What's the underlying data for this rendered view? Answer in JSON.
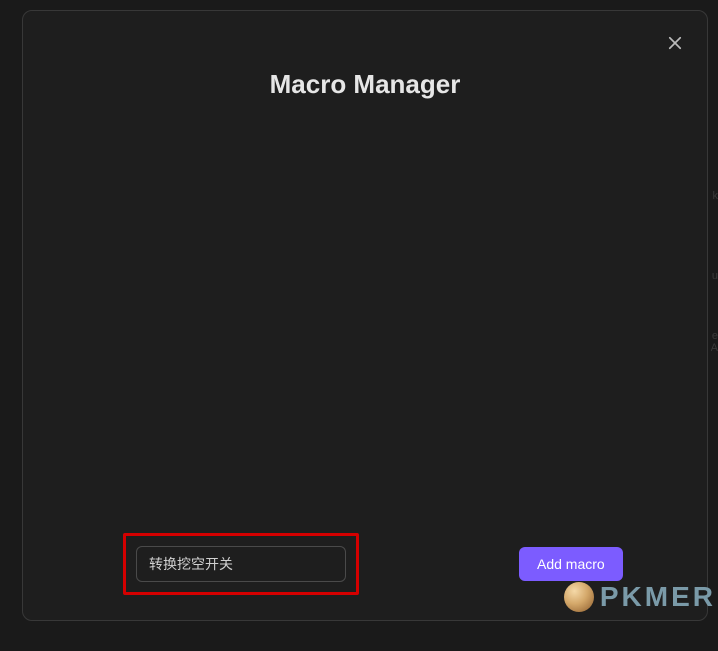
{
  "modal": {
    "title": "Macro Manager"
  },
  "input": {
    "value": "转换挖空开关"
  },
  "buttons": {
    "add": "Add macro"
  },
  "watermark": {
    "text": "PKMER"
  },
  "bg": {
    "t1": "k",
    "t2": "u",
    "t3": "e",
    "t4": "A"
  }
}
